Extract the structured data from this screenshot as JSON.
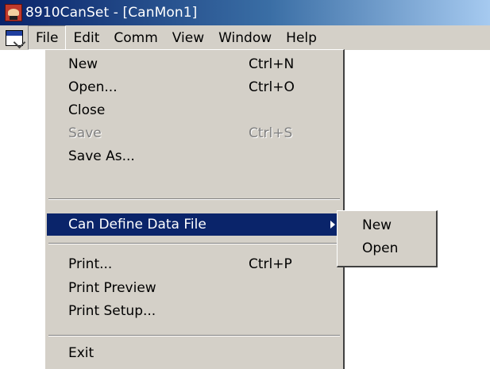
{
  "window": {
    "title": "8910CanSet - [CanMon1]",
    "app_icon": "app-icon",
    "doc_icon": "document-icon"
  },
  "menubar": {
    "items": [
      {
        "label": "File",
        "active": true
      },
      {
        "label": "Edit"
      },
      {
        "label": "Comm"
      },
      {
        "label": "View"
      },
      {
        "label": "Window"
      },
      {
        "label": "Help"
      }
    ]
  },
  "file_menu": {
    "items": [
      {
        "label": "New",
        "shortcut": "Ctrl+N"
      },
      {
        "label": "Open...",
        "shortcut": "Ctrl+O"
      },
      {
        "label": "Close"
      },
      {
        "label": "Save",
        "shortcut": "Ctrl+S",
        "disabled": true
      },
      {
        "label": "Save As..."
      },
      {
        "label": "Can Define Data File",
        "highlighted": true,
        "submenu": true
      },
      {
        "label": "Print...",
        "shortcut": "Ctrl+P"
      },
      {
        "label": "Print Preview"
      },
      {
        "label": "Print Setup..."
      },
      {
        "label": "Exit"
      }
    ]
  },
  "submenu": {
    "items": [
      {
        "label": "New"
      },
      {
        "label": "Open"
      }
    ]
  },
  "colors": {
    "highlight": "#0a246a",
    "menu_bg": "#d4d0c8",
    "disabled_text": "#808080"
  }
}
